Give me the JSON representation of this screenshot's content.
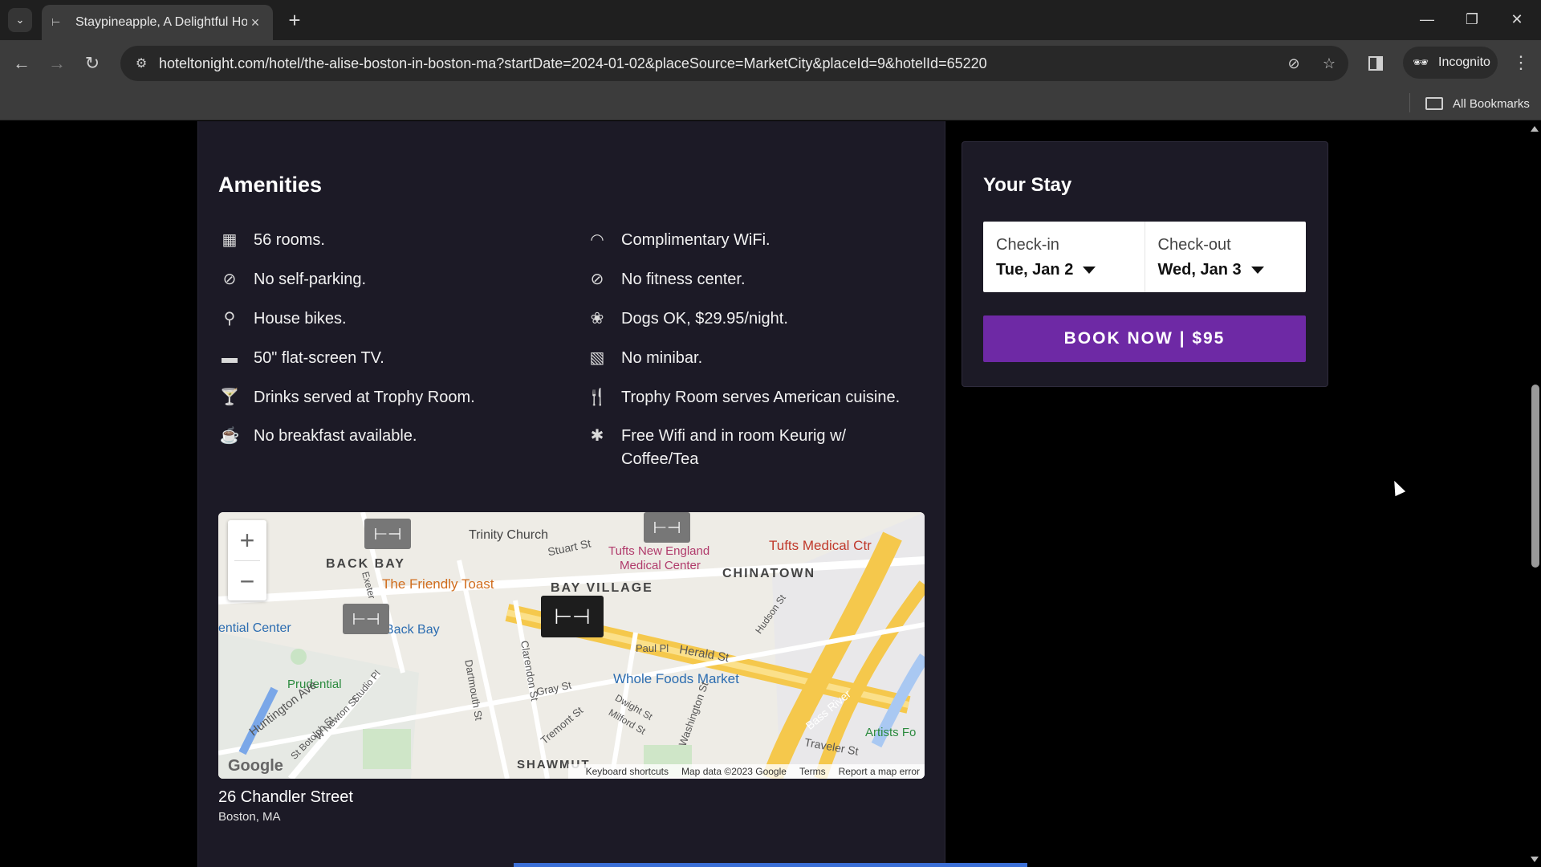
{
  "browser": {
    "tab_title": "Staypineapple, A Delightful Hot",
    "tab_favicon_icon": "bed-icon",
    "url": "hoteltonight.com/hotel/the-alise-boston-in-boston-ma?startDate=2024-01-02&placeSource=MarketCity&placeId=9&hotelId=65220",
    "incognito_label": "Incognito",
    "bookmarks_label": "All Bookmarks"
  },
  "amenities": {
    "title": "Amenities",
    "left": [
      {
        "icon": "building-icon",
        "text": "56 rooms."
      },
      {
        "icon": "no-parking-icon",
        "text": "No self-parking."
      },
      {
        "icon": "bike-icon",
        "text": "House bikes."
      },
      {
        "icon": "tv-icon",
        "text": "50\" flat-screen TV."
      },
      {
        "icon": "drinks-icon",
        "text": "Drinks served at Trophy Room."
      },
      {
        "icon": "no-breakfast-icon",
        "text": "No breakfast available."
      }
    ],
    "right": [
      {
        "icon": "wifi-icon",
        "text": "Complimentary WiFi."
      },
      {
        "icon": "no-fitness-icon",
        "text": "No fitness center."
      },
      {
        "icon": "paw-icon",
        "text": "Dogs OK, $29.95/night."
      },
      {
        "icon": "no-minibar-icon",
        "text": "No minibar."
      },
      {
        "icon": "utensils-icon",
        "text": "Trophy Room serves American cuisine."
      },
      {
        "icon": "asterisk-icon",
        "text": "Free Wifi and in room Keurig w/",
        "text2": "Coffee/Tea"
      }
    ]
  },
  "map": {
    "labels": {
      "trinity": "Trinity Church",
      "backbay": "BACK BAY",
      "stuart": "Stuart St",
      "tufts_ne": "Tufts New England",
      "tufts_ne2": "Medical Center",
      "tufts_med": "Tufts Medical Ctr",
      "chinatown": "CHINATOWN",
      "friendly": "The Friendly Toast",
      "bayvillage": "BAY VILLAGE",
      "center": "ential Center",
      "backbay_st": "Back Bay",
      "paul": "Paul Pl",
      "herald": "Herald St",
      "hudson": "Hudson St",
      "prudential": "Prudential",
      "wholefoods": "Whole Foods Market",
      "clarendon": "Clarendon St",
      "dartmouth": "Dartmouth St",
      "gray": "Gray St",
      "washington": "Washington St",
      "tremont": "Tremont St",
      "milford": "Milford St",
      "dwight": "Dwight St",
      "huntington": "Huntington Ave",
      "shawmut": "SHAWMUT",
      "bassriver": "Bass River",
      "artists": "Artists Fo",
      "traveler": "Traveler St",
      "exeter": "Exeter",
      "studio": "Studio Pl",
      "wnewton": "W Newton St",
      "botolph": "St Botolph St"
    },
    "google_logo": "Google",
    "footer": {
      "shortcuts": "Keyboard shortcuts",
      "data": "Map data ©2023 Google",
      "terms": "Terms",
      "report": "Report a map error"
    }
  },
  "address": {
    "street": "26 Chandler Street",
    "city": "Boston, MA"
  },
  "stay": {
    "title": "Your Stay",
    "checkin_label": "Check-in",
    "checkin_value": "Tue, Jan 2",
    "checkout_label": "Check-out",
    "checkout_value": "Wed, Jan 3",
    "book_label": "BOOK NOW | $95"
  }
}
